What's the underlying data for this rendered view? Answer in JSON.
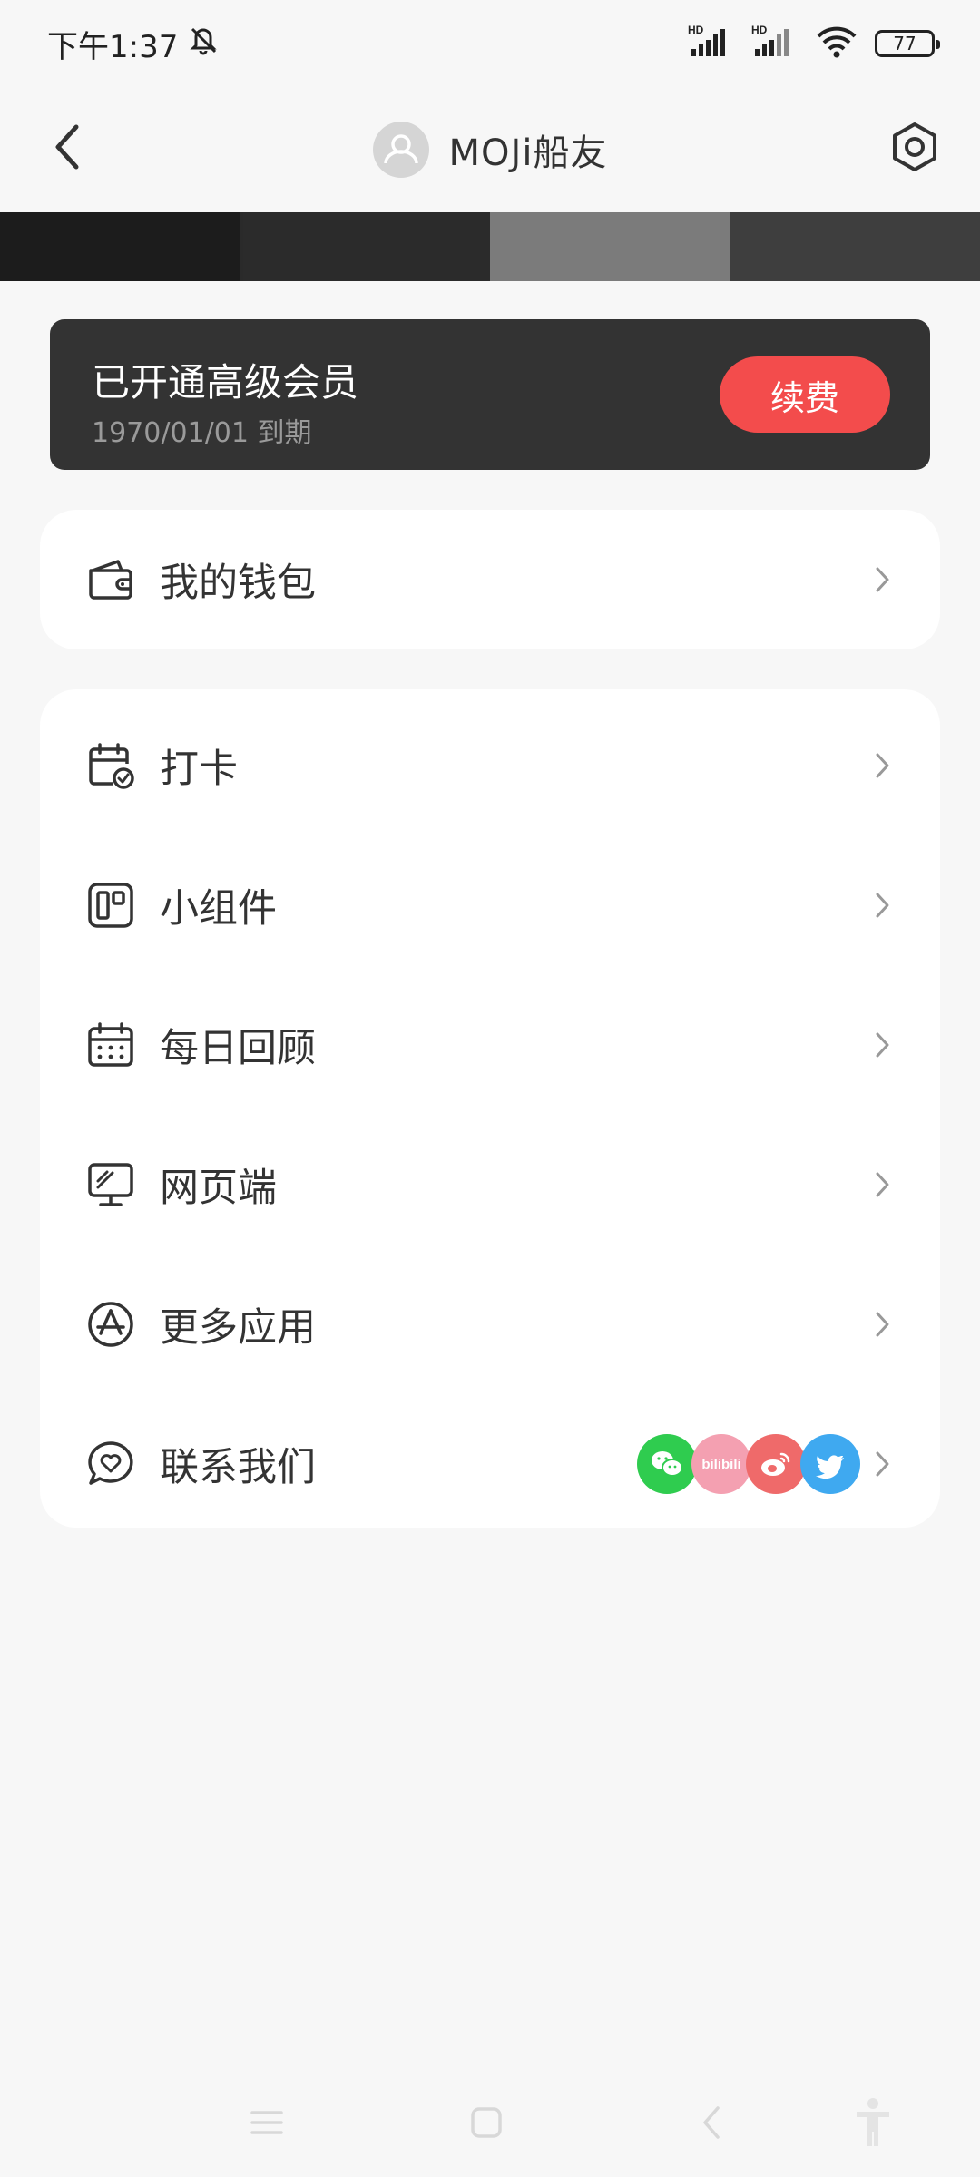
{
  "status_bar": {
    "time": "下午1:37",
    "battery": "77",
    "network_1": "HD",
    "network_2": "HD"
  },
  "header": {
    "title": "MOJi船友"
  },
  "membership": {
    "title": "已开通高级会员",
    "expiry": "1970/01/01 到期",
    "renew_label": "续费"
  },
  "wallet": {
    "label": "我的钱包",
    "icon": "wallet-icon"
  },
  "menu": [
    {
      "label": "打卡",
      "icon": "calendar-check-icon"
    },
    {
      "label": "小组件",
      "icon": "widget-icon"
    },
    {
      "label": "每日回顾",
      "icon": "calendar-icon"
    },
    {
      "label": "网页端",
      "icon": "monitor-icon"
    },
    {
      "label": "更多应用",
      "icon": "app-store-icon"
    },
    {
      "label": "联系我们",
      "icon": "chat-heart-icon"
    }
  ],
  "contact": {
    "bilibili_text": "bilibili"
  },
  "colors": {
    "accent_red": "#f34c4c",
    "member_card": "#333333",
    "wechat": "#2fcc4f",
    "bilibili": "#f4a0b1",
    "weibo": "#ef6a6a",
    "twitter": "#3fa9f0"
  }
}
